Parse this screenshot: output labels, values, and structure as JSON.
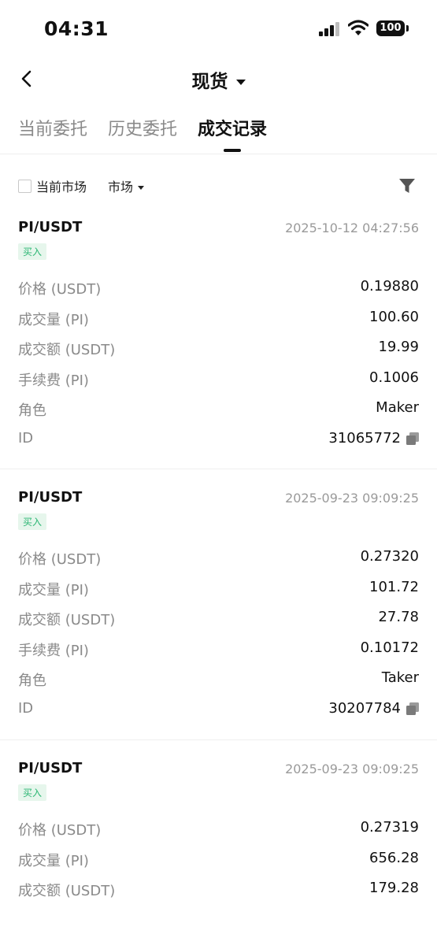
{
  "status_bar": {
    "time": "04:31",
    "battery": "100"
  },
  "nav": {
    "title": "现货"
  },
  "tabs": [
    {
      "label": "当前委托"
    },
    {
      "label": "历史委托"
    },
    {
      "label": "成交记录"
    }
  ],
  "filter": {
    "current_market_label": "当前市场",
    "market_dropdown_label": "市场"
  },
  "records": [
    {
      "pair": "PI/USDT",
      "time": "2025-10-12 04:27:56",
      "side": "买入",
      "rows": [
        {
          "label": "价格 (USDT)",
          "value": "0.19880"
        },
        {
          "label": "成交量 (PI)",
          "value": "100.60"
        },
        {
          "label": "成交额 (USDT)",
          "value": "19.99"
        },
        {
          "label": "手续费 (PI)",
          "value": "0.1006"
        },
        {
          "label": "角色",
          "value": "Maker"
        },
        {
          "label": "ID",
          "value": "31065772"
        }
      ]
    },
    {
      "pair": "PI/USDT",
      "time": "2025-09-23 09:09:25",
      "side": "买入",
      "rows": [
        {
          "label": "价格 (USDT)",
          "value": "0.27320"
        },
        {
          "label": "成交量 (PI)",
          "value": "101.72"
        },
        {
          "label": "成交额 (USDT)",
          "value": "27.78"
        },
        {
          "label": "手续费 (PI)",
          "value": "0.10172"
        },
        {
          "label": "角色",
          "value": "Taker"
        },
        {
          "label": "ID",
          "value": "30207784"
        }
      ]
    },
    {
      "pair": "PI/USDT",
      "time": "2025-09-23 09:09:25",
      "side": "买入",
      "rows": [
        {
          "label": "价格 (USDT)",
          "value": "0.27319"
        },
        {
          "label": "成交量 (PI)",
          "value": "656.28"
        },
        {
          "label": "成交额 (USDT)",
          "value": "179.28"
        }
      ]
    }
  ]
}
